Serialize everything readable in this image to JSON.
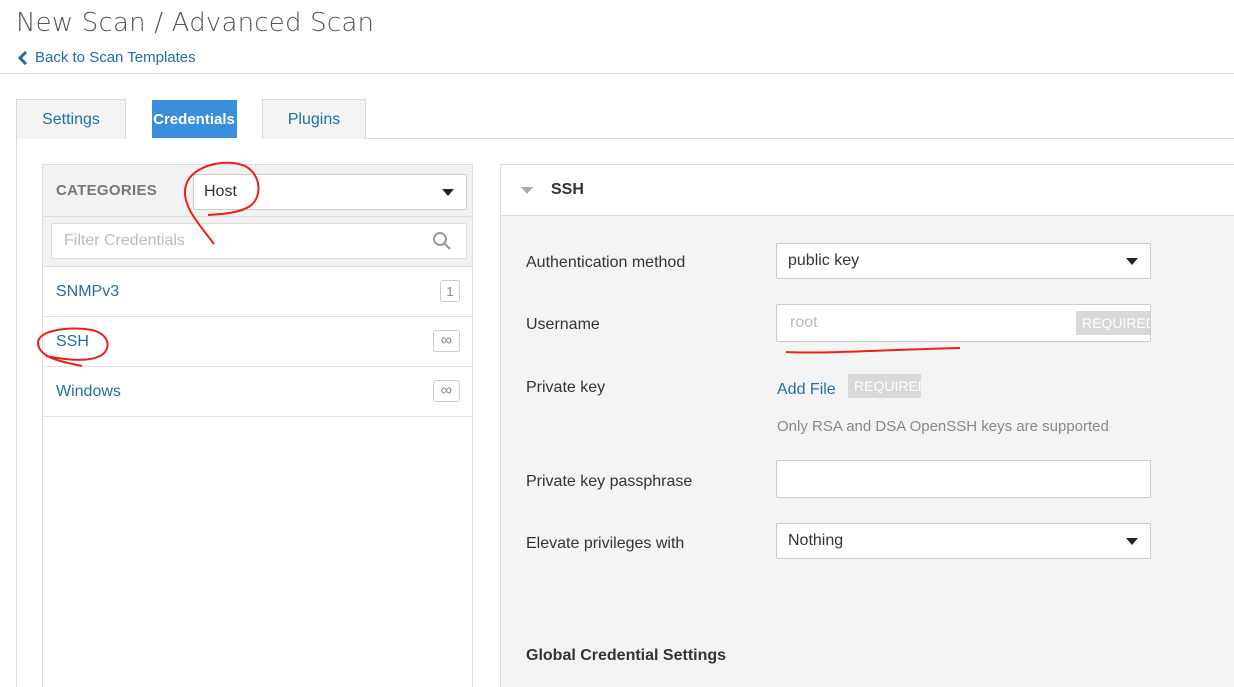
{
  "page": {
    "title": "New Scan / Advanced Scan",
    "back_link": "Back to Scan Templates"
  },
  "tabs": [
    {
      "label": "Settings",
      "active": false
    },
    {
      "label": "Credentials",
      "active": true
    },
    {
      "label": "Plugins",
      "active": false
    }
  ],
  "categories": {
    "label": "CATEGORIES",
    "selected": "Host",
    "filter_placeholder": "Filter Credentials",
    "items": [
      {
        "name": "SNMPv3",
        "badge": "1"
      },
      {
        "name": "SSH",
        "badge": "∞"
      },
      {
        "name": "Windows",
        "badge": "∞"
      }
    ]
  },
  "ssh": {
    "title": "SSH",
    "auth_label": "Authentication method",
    "auth_value": "public key",
    "username_label": "Username",
    "username_placeholder": "root",
    "required": "REQUIRED",
    "private_key_label": "Private key",
    "add_file": "Add File",
    "private_key_help": "Only RSA and DSA OpenSSH keys are supported",
    "passphrase_label": "Private key passphrase",
    "passphrase_value": "",
    "elevate_label": "Elevate privileges with",
    "elevate_value": "Nothing"
  },
  "global_settings_title": "Global Credential Settings",
  "colors": {
    "link": "#1f6ea8",
    "active_tab": "#3a8fdc",
    "annotation": "#e8211a"
  }
}
